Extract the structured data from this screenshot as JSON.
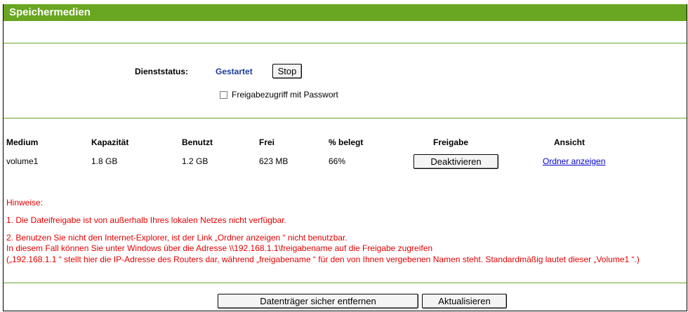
{
  "header": {
    "title": "Speichermedien"
  },
  "service": {
    "label": "Dienststatus:",
    "value": "Gestartet",
    "stop_button": "Stop",
    "password_checkbox_label": "Freigabezugriff mit Passwort",
    "password_checked": false
  },
  "table": {
    "headers": [
      "Medium",
      "Kapazität",
      "Benutzt",
      "Frei",
      "% belegt",
      "Freigabe",
      "Ansicht"
    ],
    "rows": [
      {
        "medium": "volume1",
        "capacity": "1.8 GB",
        "used": "1.2 GB",
        "free": "623 MB",
        "percent": "66%",
        "share_button": "Deaktivieren",
        "view_link": "Ordner anzeigen"
      }
    ]
  },
  "notes": {
    "heading": "Hinweise:",
    "note1": "1. Die Dateifreigabe ist von außerhalb Ihres lokalen Netzes nicht verfügbar.",
    "note2_line1": "2. Benutzen Sie nicht den Internet-Explorer, ist der Link „Ordner anzeigen “ nicht benutzbar.",
    "note2_line2": "In diesem Fall können Sie unter Windows über die Adresse \\\\192.168.1.1\\freigabename auf die Freigabe zugreifen",
    "note2_line3": "(„192.168.1.1 “ stellt hier die IP-Adresse des Routers dar, während „freigabename “ für den von Ihnen vergebenen Namen steht. Standardmäßig lautet dieser „Volume1 “.)"
  },
  "footer": {
    "eject_button": "Datenträger sicher entfernen",
    "refresh_button": "Aktualisieren"
  },
  "colors": {
    "header_bg": "#69a621",
    "divider": "#6aa62b",
    "status_text": "#1a3c9c",
    "note_text": "#e30000",
    "link": "#0000cc"
  }
}
